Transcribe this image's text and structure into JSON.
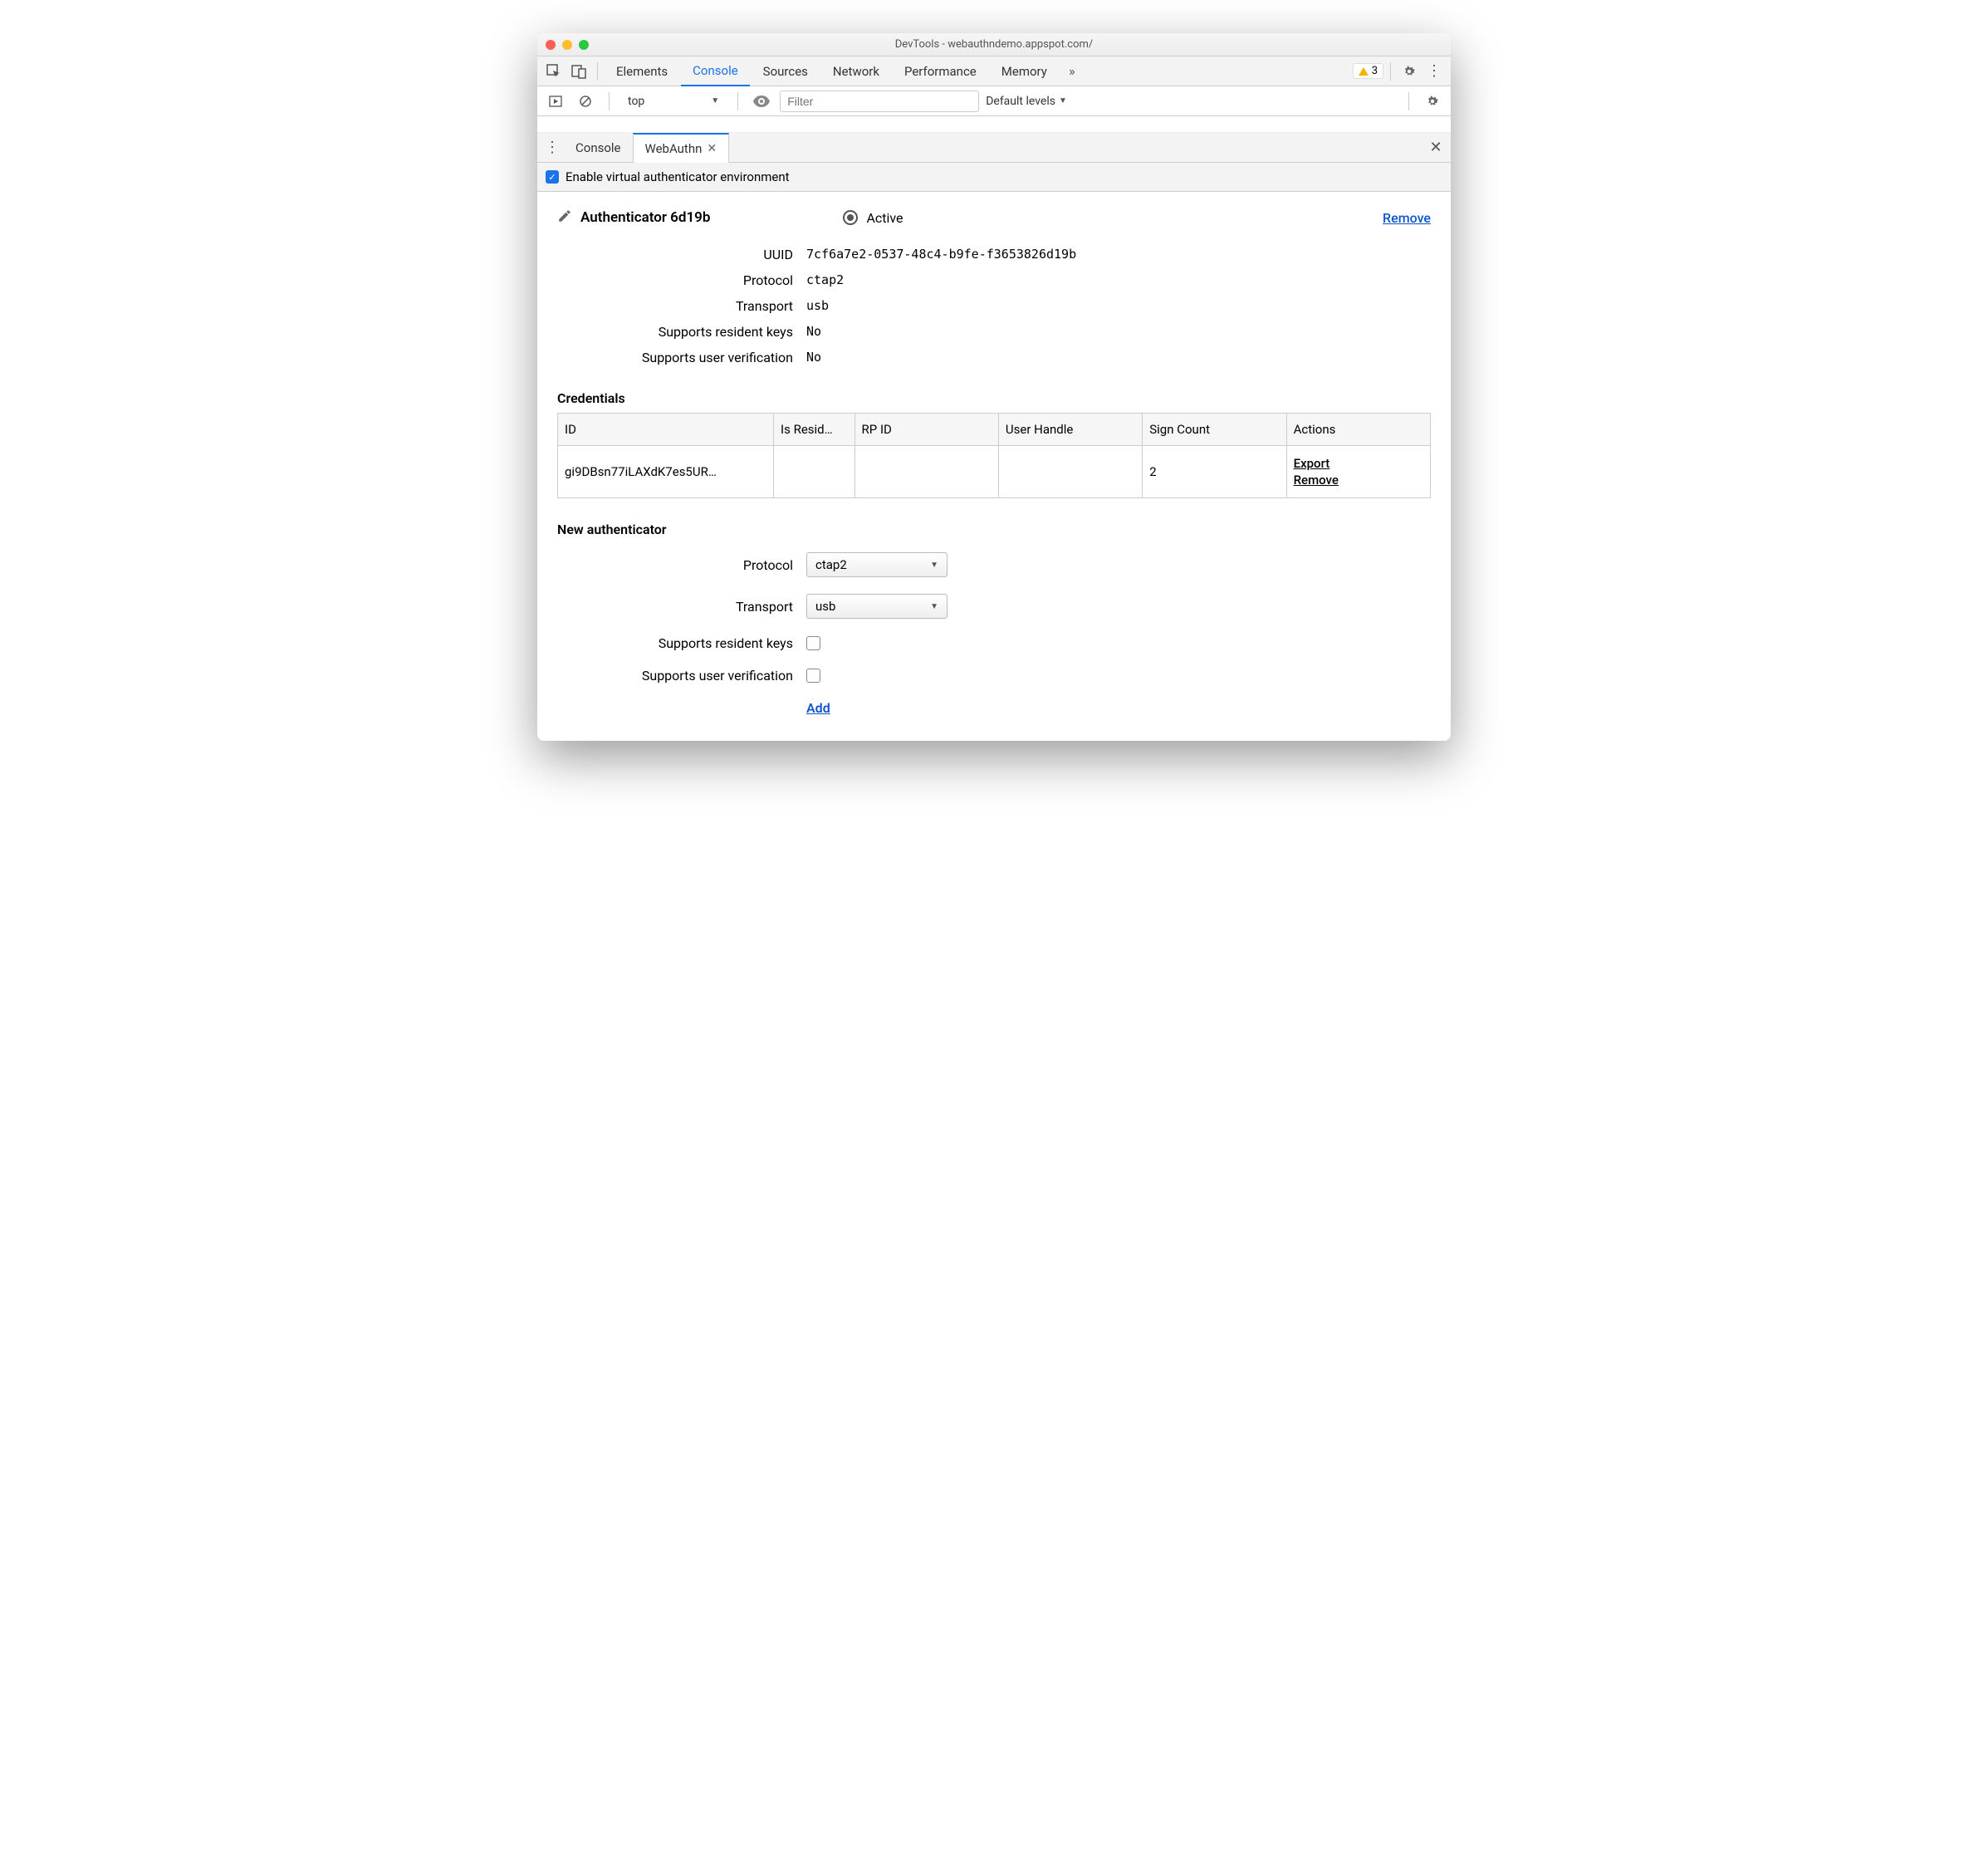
{
  "window": {
    "title": "DevTools - webauthndemo.appspot.com/"
  },
  "mainTabs": {
    "elements": "Elements",
    "console": "Console",
    "sources": "Sources",
    "network": "Network",
    "performance": "Performance",
    "memory": "Memory"
  },
  "warnings": {
    "count": "3"
  },
  "consoleBar": {
    "context": "top",
    "filterPlaceholder": "Filter",
    "levels": "Default levels"
  },
  "drawer": {
    "consoleTab": "Console",
    "webauthnTab": "WebAuthn"
  },
  "enable": {
    "label": "Enable virtual authenticator environment"
  },
  "authenticator": {
    "title": "Authenticator 6d19b",
    "activeLabel": "Active",
    "removeLabel": "Remove",
    "details": {
      "uuidLabel": "UUID",
      "uuidValue": "7cf6a7e2-0537-48c4-b9fe-f3653826d19b",
      "protocolLabel": "Protocol",
      "protocolValue": "ctap2",
      "transportLabel": "Transport",
      "transportValue": "usb",
      "residentLabel": "Supports resident keys",
      "residentValue": "No",
      "userVerLabel": "Supports user verification",
      "userVerValue": "No"
    }
  },
  "credentials": {
    "heading": "Credentials",
    "headers": {
      "id": "ID",
      "resident": "Is Resid…",
      "rpid": "RP ID",
      "userHandle": "User Handle",
      "signCount": "Sign Count",
      "actions": "Actions"
    },
    "row": {
      "id": "gi9DBsn77iLAXdK7es5UR…",
      "resident": "",
      "rpid": "",
      "userHandle": "",
      "signCount": "2",
      "export": "Export",
      "remove": "Remove"
    }
  },
  "newAuth": {
    "heading": "New authenticator",
    "protocolLabel": "Protocol",
    "protocolValue": "ctap2",
    "transportLabel": "Transport",
    "transportValue": "usb",
    "residentLabel": "Supports resident keys",
    "userVerLabel": "Supports user verification",
    "addLabel": "Add"
  }
}
